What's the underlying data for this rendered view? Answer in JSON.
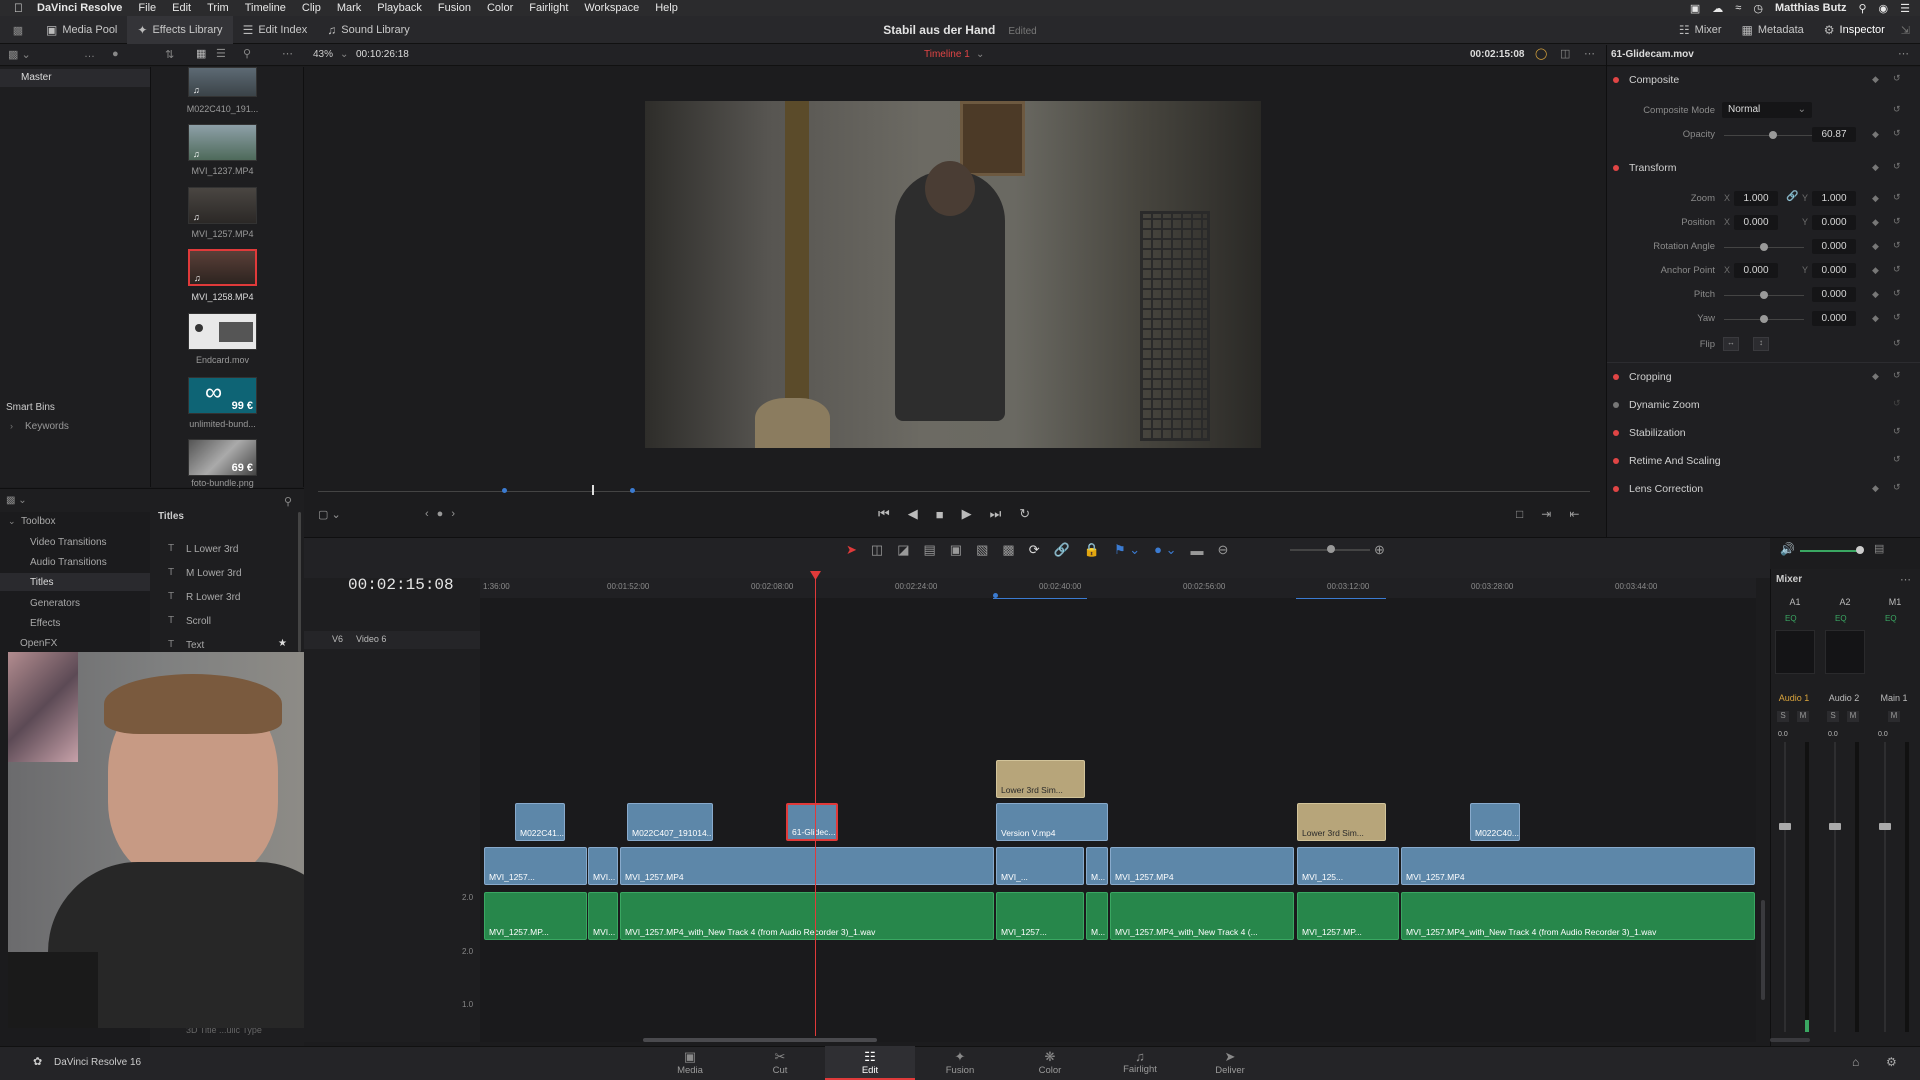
{
  "menubar": {
    "app_name": "DaVinci Resolve",
    "menus": [
      "File",
      "Edit",
      "Trim",
      "Timeline",
      "Clip",
      "Mark",
      "Playback",
      "Fusion",
      "Color",
      "Fairlight",
      "Workspace",
      "Help"
    ],
    "user": "Matthias Butz"
  },
  "toolbar": {
    "media_pool": "Media Pool",
    "effects_library": "Effects Library",
    "edit_index": "Edit Index",
    "sound_library": "Sound Library",
    "project_title": "Stabil aus der Hand",
    "project_status": "Edited",
    "mixer": "Mixer",
    "metadata": "Metadata",
    "inspector": "Inspector"
  },
  "viewer": {
    "zoom": "43%",
    "timecode_left": "00:10:26:18",
    "timeline_name": "Timeline 1",
    "timecode_right": "00:02:15:08",
    "clip_name": "61-Glidecam.mov"
  },
  "media_pool": {
    "bin": "Master",
    "smart_bins": "Smart Bins",
    "keywords": "Keywords",
    "clips": [
      {
        "name": "M022C410_191..."
      },
      {
        "name": "MVI_1237.MP4"
      },
      {
        "name": "MVI_1257.MP4"
      },
      {
        "name": "MVI_1258.MP4"
      },
      {
        "name": "Endcard.mov"
      },
      {
        "name": "unlimited-bund...",
        "price": "99 €"
      },
      {
        "name": "foto-bundle.png",
        "price": "69 €"
      }
    ]
  },
  "effects": {
    "toolbox": "Toolbox",
    "categories": [
      "Video Transitions",
      "Audio Transitions",
      "Titles",
      "Generators",
      "Effects",
      "OpenFX"
    ],
    "titles_header": "Titles",
    "titles": [
      "L Lower 3rd",
      "M Lower 3rd",
      "R Lower 3rd",
      "Scroll",
      "Text"
    ],
    "footer_item": "3D Title ...ulic Type"
  },
  "inspector": {
    "composite": "Composite",
    "composite_mode_label": "Composite Mode",
    "composite_mode": "Normal",
    "opacity_label": "Opacity",
    "opacity": "60.87",
    "transform": "Transform",
    "zoom_label": "Zoom",
    "zoom_x": "1.000",
    "zoom_y": "1.000",
    "position_label": "Position",
    "position_x": "0.000",
    "position_y": "0.000",
    "rotation_label": "Rotation Angle",
    "rotation": "0.000",
    "anchor_label": "Anchor Point",
    "anchor_x": "0.000",
    "anchor_y": "0.000",
    "pitch_label": "Pitch",
    "pitch": "0.000",
    "yaw_label": "Yaw",
    "yaw": "0.000",
    "flip_label": "Flip",
    "axis_x": "X",
    "axis_y": "Y",
    "sections": [
      "Cropping",
      "Dynamic Zoom",
      "Stabilization",
      "Retime And Scaling",
      "Lens Correction"
    ]
  },
  "timeline": {
    "timecode": "00:02:15:08",
    "track_v6": "V6",
    "track_v6_name": "Video 6",
    "ruler": [
      "1:36:00",
      "00:01:52:00",
      "00:02:08:00",
      "00:02:24:00",
      "00:02:40:00",
      "00:02:56:00",
      "00:03:12:00",
      "00:03:28:00",
      "00:03:44:00"
    ],
    "gain_labels": [
      "2.0",
      "2.0",
      "1.0"
    ],
    "clips": {
      "v3a": "M022C41...",
      "v3b": "M022C407_191014...",
      "v3c": "61-Glidec...",
      "t1": "Lower 3rd Sim...",
      "v3d": "Version V.mp4",
      "t2": "Lower 3rd Sim...",
      "v3e": "M022C40...",
      "v1a": "MVI_1257...",
      "v1b": "MVI...",
      "v1c": "MVI_1257.MP4",
      "v1d": "MVI_...",
      "v1e": "M...",
      "v1f": "MVI_1257.MP4",
      "v1g": "MVI_125...",
      "v1h": "MVI_1257.MP4",
      "a1a": "MVI_1257.MP...",
      "a1b": "MVI...",
      "a1c": "MVI_1257.MP4_with_New Track 4 (from Audio Recorder 3)_1.wav",
      "a1d": "MVI_1257...",
      "a1e": "M...",
      "a1f": "MVI_1257.MP4_with_New Track 4 (...",
      "a1g": "MVI_1257.MP...",
      "a1h": "MVI_1257.MP4_with_New Track 4 (from Audio Recorder 3)_1.wav"
    }
  },
  "mixer": {
    "title": "Mixer",
    "channels": [
      "A1",
      "A2",
      "M1"
    ],
    "eq": "EQ",
    "names": [
      "Audio 1",
      "Audio 2",
      "Main 1"
    ],
    "solo": "S",
    "mute": "M",
    "levels": [
      "0.0",
      "0.0",
      "0.0"
    ]
  },
  "pages": [
    "Media",
    "Cut",
    "Edit",
    "Fusion",
    "Color",
    "Fairlight",
    "Deliver"
  ],
  "footer": {
    "app_version": "DaVinci Resolve 16"
  }
}
